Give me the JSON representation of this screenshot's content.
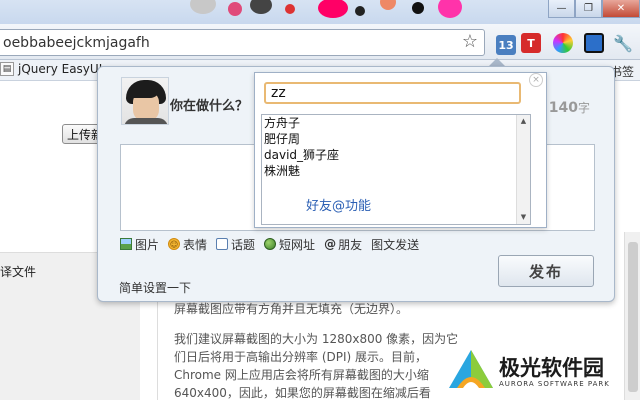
{
  "browser": {
    "address_bar": {
      "url": "oebbabeejckmjagafh"
    },
    "window_controls": {
      "minimize": "—",
      "restore": "❐",
      "close": "✕"
    },
    "extensions": [
      {
        "name": "badge-13",
        "text": "13",
        "color": "#4a7fc0"
      },
      {
        "name": "t-extension",
        "text": "T",
        "color": "#d62b2b"
      },
      {
        "name": "color-wheel",
        "text": "",
        "color": "#333333"
      },
      {
        "name": "weibo-extension",
        "text": "",
        "color": "#2c6fc9"
      },
      {
        "name": "wrench",
        "text": "",
        "color": "#555555"
      }
    ],
    "bookmarks": [
      {
        "label": "jQuery EasyUI"
      }
    ],
    "bookmarks_right": "书签"
  },
  "page": {
    "upload_button": "上传新",
    "left_label": "译文件",
    "doc_lines": [
      "屏幕截图应带有方角并且无填充（无边界）。",
      "",
      "我们建议屏幕截图的大小为 1280x800 像素，因为它",
      "们日后将用于高输出分辨率 (DPI) 展示。目前，",
      "Chrome 网上应用店会将所有屏幕截图的大小缩",
      "640x400，因此，如果您的屏幕截图在缩减后看"
    ]
  },
  "popup": {
    "prompt": "你在做什么？",
    "counter_number": "140",
    "counter_unit": "字",
    "tools": [
      {
        "label": "图片",
        "icon": "picture-icon"
      },
      {
        "label": "表情",
        "icon": "smiley-icon"
      },
      {
        "label": "话题",
        "icon": "topic-bubble-icon"
      },
      {
        "label": "短网址",
        "icon": "globe-icon"
      },
      {
        "label": "朋友",
        "icon": "at-icon"
      },
      {
        "label": "图文发送",
        "icon": ""
      }
    ],
    "settings_link": "简单设置一下",
    "publish_button": "发布"
  },
  "friend_dropdown": {
    "input_value": "zz",
    "items": [
      "方舟子",
      "肥仔周",
      "david_狮子座",
      "株洲魅"
    ],
    "footer": "好友@功能",
    "close_glyph": "×"
  },
  "watermark": {
    "title": "极光软件园",
    "subtitle": "AURORA SOFTWARE PARK"
  }
}
